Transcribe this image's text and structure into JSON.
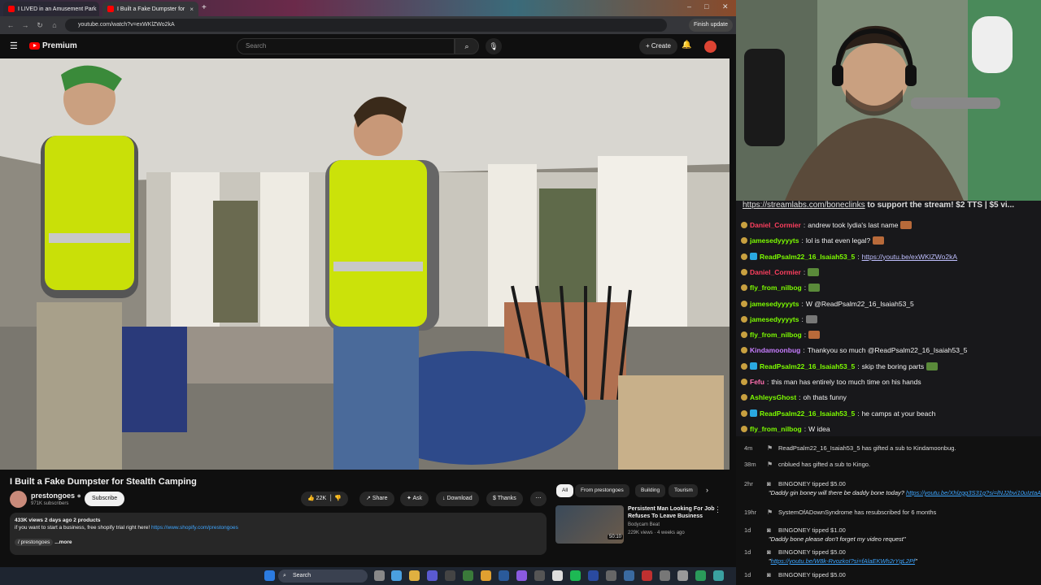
{
  "browser": {
    "tabs": [
      {
        "label": "I LIVED in an Amusement Park"
      },
      {
        "label": "I Built a Fake Dumpster for"
      }
    ],
    "url": "youtube.com/watch?v=exWKlZWo2kA",
    "finish_update": "Finish update"
  },
  "youtube": {
    "logo_text": "Premium",
    "search_placeholder": "Search",
    "create_label": "+ Create",
    "video": {
      "title": "I Built a Fake Dumpster for Stealth Camping",
      "channel": "prestongoes",
      "subscribers": "971K subscribers",
      "subscribe_label": "Subscribe",
      "likes": "22K",
      "share_label": "Share",
      "ask_label": "Ask",
      "download_label": "Download",
      "thanks_label": "Thanks",
      "desc_meta": "433K views  2 days ago  2 products",
      "desc_text": "if you want to start a business, free shopify trial right here! ",
      "desc_link": "https://www.shopify.com/prestongoes",
      "desc_channel": "/ prestongoes",
      "desc_more": "...more"
    },
    "chips": [
      "All",
      "From prestongoes",
      "Building",
      "Tourism"
    ],
    "recommended": {
      "title": "Persistent Man Looking For Job Refuses To Leave Business",
      "channel": "Bodycam Beat",
      "meta": "229K views · 4 weeks ago",
      "duration": "50:10"
    }
  },
  "stream": {
    "ticker_link": "https://streamlabs.com/boneclinks",
    "ticker_text": " to support the stream! $2 TTS | $5 vi...",
    "chat": [
      {
        "user": "Daniel_Cormier",
        "color": "#ff3f5f",
        "text": "andrew took lydia's last name",
        "emote": "y"
      },
      {
        "user": "jamesedyyyyts",
        "color": "#7cfc00",
        "text": "lol is that even legal?",
        "emote": "y"
      },
      {
        "user": "ReadPsalm22_16_Isaiah53_5",
        "color": "#7cfc00",
        "text": "",
        "link": "https://youtu.be/exWKlZWo2kA"
      },
      {
        "user": "Daniel_Cormier",
        "color": "#ff3f5f",
        "text": "",
        "emote": "g"
      },
      {
        "user": "fly_from_nilbog",
        "color": "#7cfc00",
        "text": "",
        "emote": "g"
      },
      {
        "user": "jamesedyyyyts",
        "color": "#7cfc00",
        "text": "W @ReadPsalm22_16_Isaiah53_5"
      },
      {
        "user": "jamesedyyyyts",
        "color": "#7cfc00",
        "text": "",
        "emote": "gr"
      },
      {
        "user": "fly_from_nilbog",
        "color": "#7cfc00",
        "text": "",
        "emote": "y"
      },
      {
        "user": "Kindamoonbug",
        "color": "#c77dff",
        "text": "Thankyou so much @ReadPsalm22_16_Isaiah53_5"
      },
      {
        "user": "ReadPsalm22_16_Isaiah53_5",
        "color": "#7cfc00",
        "text": "skip the boring parts",
        "emote": "g"
      },
      {
        "user": "Fefu",
        "color": "#ff6fb0",
        "text": "this man has entirely too much time on his hands"
      },
      {
        "user": "AshleysGhost",
        "color": "#7cfc00",
        "text": "oh thats funny"
      },
      {
        "user": "ReadPsalm22_16_Isaiah53_5",
        "color": "#7cfc00",
        "text": "he camps at your beach"
      },
      {
        "user": "fly_from_nilbog",
        "color": "#7cfc00",
        "text": "W idea"
      }
    ],
    "events": [
      {
        "time": "4m",
        "line": "ReadPsalm22_16_Isaiah53_5 has gifted a sub to Kindamoonbug."
      },
      {
        "time": "38m",
        "line": "cnblued has gifted a sub to Kingo."
      },
      {
        "time": "2hr",
        "line": "BINGONEY tipped $5.00",
        "sub": "\"Daddy gin boney will there be daddy bone today? ",
        "sub_link": "https://youtu.be/Xhlzgg3S31g?si=lNJ2bvi10uIztaAl",
        "sub_end": "\""
      },
      {
        "time": "19hr",
        "line": "SystemOfADownSyndrome has resubscribed for 6 months"
      },
      {
        "time": "1d",
        "line": "BINGONEY tipped $1.00",
        "sub": "\"Daddy bone please don't forget my video request\""
      },
      {
        "time": "1d",
        "line": "BINGONEY tipped $5.00",
        "sub": "\"",
        "sub_link": "https://youtu.be/W8k-RvozkoI?si=fAlaEKWh2rYgL2Pf",
        "sub_end": "\""
      },
      {
        "time": "1d",
        "line": "BINGONEY tipped $5.00"
      }
    ]
  },
  "taskbar": {
    "search_label": "Search"
  }
}
